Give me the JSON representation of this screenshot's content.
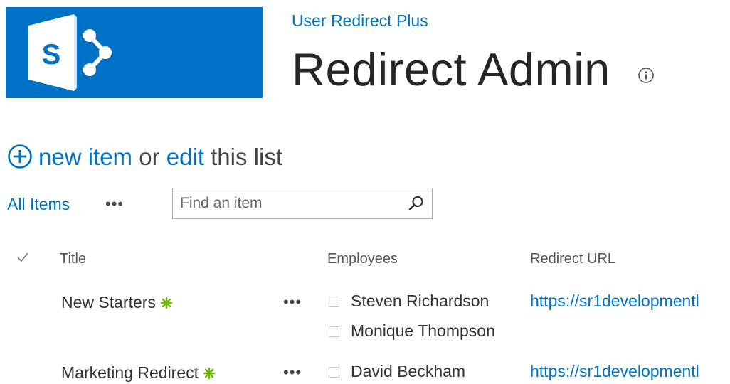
{
  "header": {
    "site_name": "User Redirect Plus",
    "page_title": "Redirect Admin"
  },
  "actions": {
    "new_item": "new item",
    "or": "or",
    "edit": "edit",
    "this_list": "this list"
  },
  "view": {
    "current_view": "All Items",
    "more": "•••"
  },
  "search": {
    "placeholder": "Find an item"
  },
  "table": {
    "columns": [
      "Title",
      "Employees",
      "Redirect URL"
    ],
    "rows": [
      {
        "title": "New Starters",
        "employees": [
          "Steven Richardson",
          "Monique Thompson"
        ],
        "url": "https://sr1developmentl"
      },
      {
        "title": "Marketing Redirect",
        "employees": [
          "David Beckham"
        ],
        "url": "https://sr1developmentl"
      }
    ]
  },
  "colors": {
    "brand_blue": "#0072c6",
    "new_badge_green": "#6bb700"
  },
  "icons": [
    "sharepoint-logo-icon",
    "info-icon",
    "add-circle-icon",
    "search-icon",
    "checkmark-icon",
    "new-item-badge-icon",
    "checkbox-icon"
  ]
}
